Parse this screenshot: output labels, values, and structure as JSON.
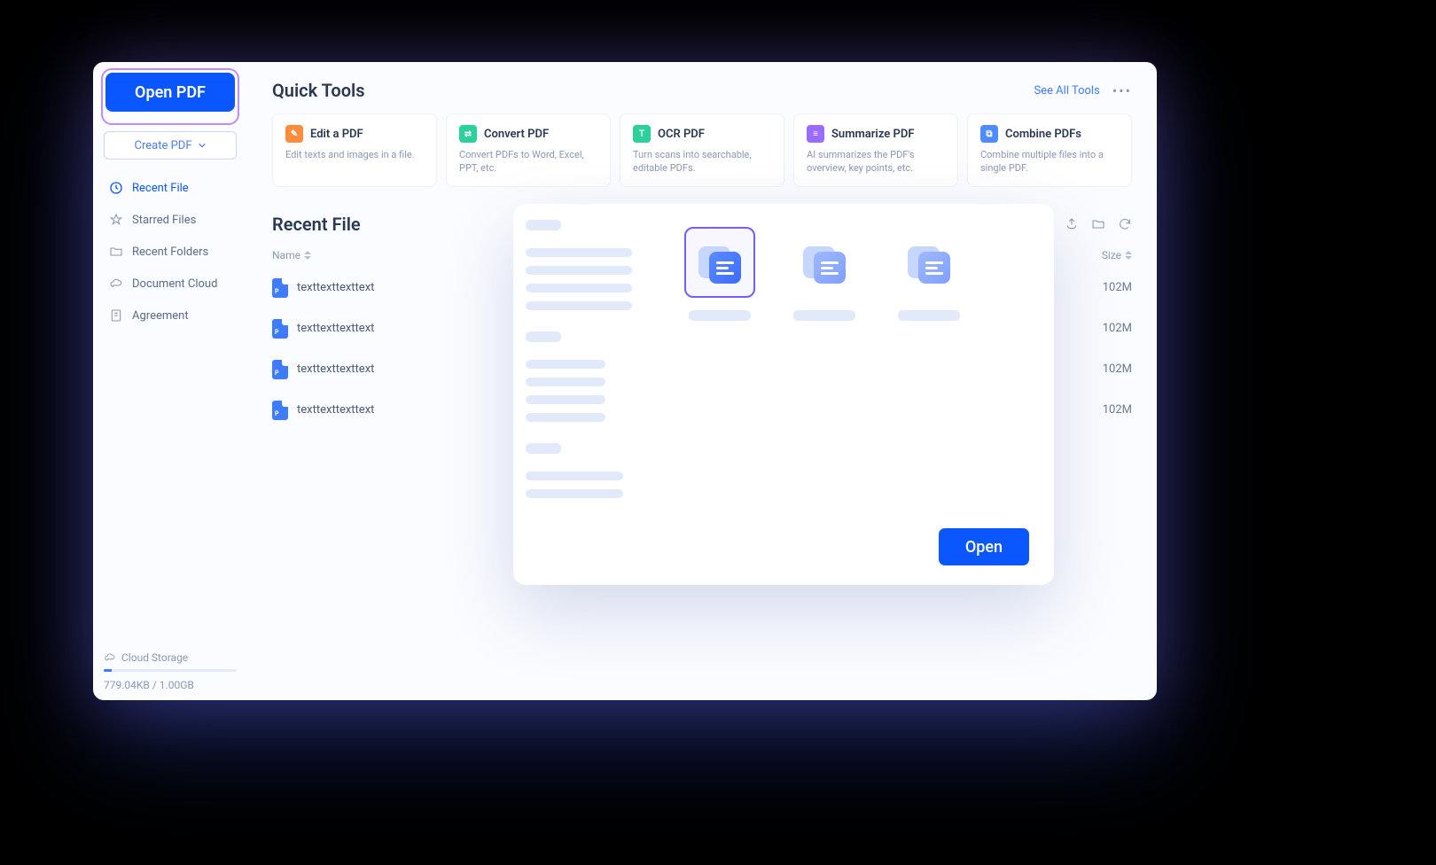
{
  "sidebar": {
    "open_pdf": "Open PDF",
    "create_pdf": "Create PDF",
    "nav": [
      {
        "label": "Recent File"
      },
      {
        "label": "Starred Files"
      },
      {
        "label": "Recent Folders"
      },
      {
        "label": "Document Cloud"
      },
      {
        "label": "Agreement"
      }
    ],
    "storage_label": "Cloud Storage",
    "storage_used": "779.04KB / 1.00GB"
  },
  "quick_tools": {
    "heading": "Quick Tools",
    "see_all": "See All Tools",
    "items": [
      {
        "title": "Edit a PDF",
        "desc": "Edit texts and images in a file.",
        "color": "#ff8c3d"
      },
      {
        "title": "Convert PDF",
        "desc": "Convert PDFs to Word, Excel, PPT, etc.",
        "color": "#2bd19a"
      },
      {
        "title": "OCR PDF",
        "desc": "Turn scans into searchable, editable PDFs.",
        "color": "#2bd19a"
      },
      {
        "title": "Summarize PDF",
        "desc": "AI summarizes the PDF's overview, key points, etc.",
        "color": "#9a6bff"
      },
      {
        "title": "Combine PDFs",
        "desc": "Combine multiple files into a single PDF.",
        "color": "#4d8bff"
      }
    ]
  },
  "recent": {
    "heading": "Recent File",
    "col_name": "Name",
    "col_size": "Size",
    "rows": [
      {
        "name": "texttexttexttext",
        "size": "102M"
      },
      {
        "name": "texttexttexttext",
        "size": "102M"
      },
      {
        "name": "texttexttexttext",
        "size": "102M"
      },
      {
        "name": "texttexttexttext",
        "size": "102M"
      }
    ]
  },
  "dialog": {
    "open": "Open"
  }
}
